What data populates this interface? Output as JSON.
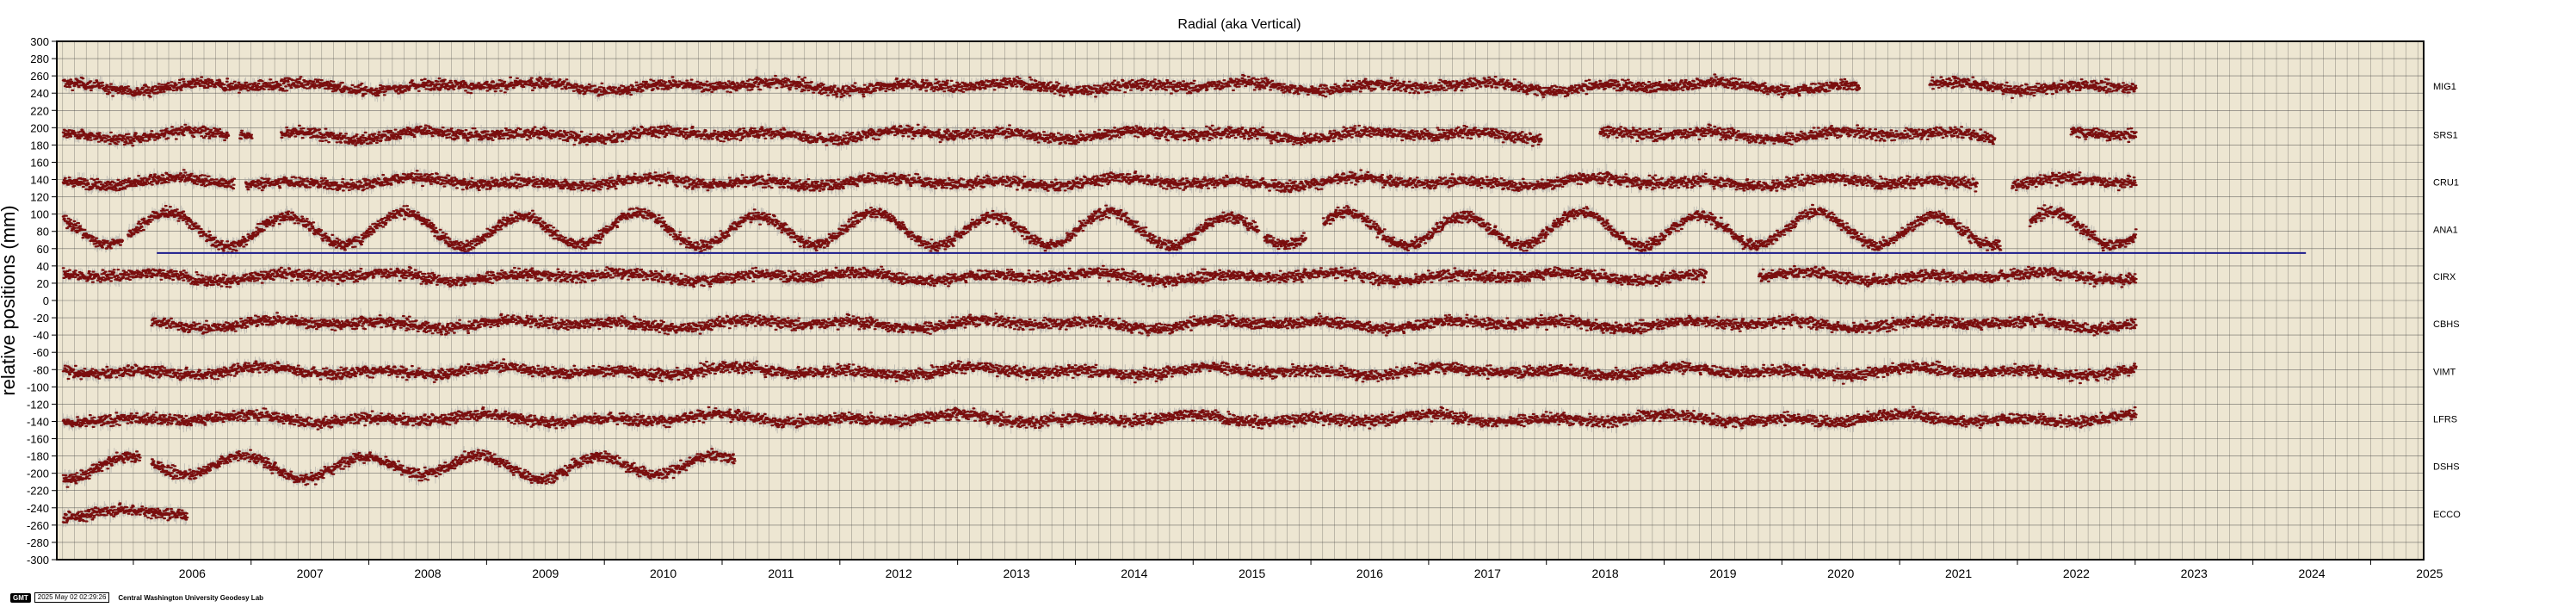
{
  "chart_data": {
    "type": "scatter",
    "title": "Radial (aka Vertical)",
    "ylabel": "relative positions (mm)",
    "xlabel": "",
    "xlim": [
      2005.35,
      2025.45
    ],
    "ylim": [
      -300,
      300
    ],
    "x_ticks": [
      "2006",
      "2007",
      "2008",
      "2009",
      "2010",
      "2011",
      "2012",
      "2013",
      "2014",
      "2015",
      "2016",
      "2017",
      "2018",
      "2019",
      "2020",
      "2021",
      "2022",
      "2023",
      "2024",
      "2025"
    ],
    "y_ticks": [
      300,
      280,
      260,
      240,
      220,
      200,
      180,
      160,
      140,
      120,
      100,
      80,
      60,
      40,
      20,
      0,
      -20,
      -40,
      -60,
      -80,
      -100,
      -120,
      -140,
      -160,
      -180,
      -200,
      -220,
      -240,
      -260,
      -280,
      -300
    ],
    "grid": true,
    "background": "#ede6d2",
    "point_color": "#7a0e0e",
    "error_color": "#a0a0a0",
    "reference_line": {
      "y": 55,
      "x_start": 2006.2,
      "x_end": 2024.45,
      "color": "#1a1a8c"
    },
    "series": [
      {
        "name": "MIG1",
        "offset": 248,
        "segments": [
          [
            2005.4,
            2020.65
          ],
          [
            2021.25,
            2023.0
          ]
        ]
      },
      {
        "name": "SRS1",
        "offset": 192,
        "segments": [
          [
            2005.4,
            2006.8
          ],
          [
            2006.9,
            2007.0
          ],
          [
            2007.25,
            2017.95
          ],
          [
            2018.45,
            2021.8
          ],
          [
            2022.45,
            2023.0
          ]
        ]
      },
      {
        "name": "CRU1",
        "offset": 137,
        "segments": [
          [
            2005.4,
            2006.85
          ],
          [
            2006.95,
            2021.65
          ],
          [
            2021.95,
            2023.0
          ]
        ]
      },
      {
        "name": "ANA1",
        "offset": 82,
        "segments": [
          [
            2005.4,
            2005.9
          ],
          [
            2005.95,
            2015.55
          ],
          [
            2015.6,
            2015.95
          ],
          [
            2016.1,
            2021.85
          ],
          [
            2022.1,
            2023.0
          ]
        ]
      },
      {
        "name": "CIRX",
        "offset": 28,
        "segments": [
          [
            2005.4,
            2019.35
          ],
          [
            2019.8,
            2023.0
          ]
        ]
      },
      {
        "name": "CBHS",
        "offset": -27,
        "segments": [
          [
            2006.15,
            2023.0
          ]
        ]
      },
      {
        "name": "VIMT",
        "offset": -82,
        "segments": [
          [
            2005.4,
            2015.45
          ],
          [
            2015.45,
            2023.0
          ]
        ]
      },
      {
        "name": "LFRS",
        "offset": -137,
        "segments": [
          [
            2005.4,
            2023.0
          ]
        ]
      },
      {
        "name": "DSHS",
        "offset": -192,
        "segments": [
          [
            2005.4,
            2006.05
          ],
          [
            2006.15,
            2011.1
          ]
        ]
      },
      {
        "name": "ECCO",
        "offset": -247,
        "segments": [
          [
            2005.4,
            2006.45
          ]
        ]
      }
    ]
  },
  "footer": {
    "logo": "GMT",
    "timestamp": "2025 May 02 02:29:26",
    "credit": "Central Washington University Geodesy Lab"
  }
}
